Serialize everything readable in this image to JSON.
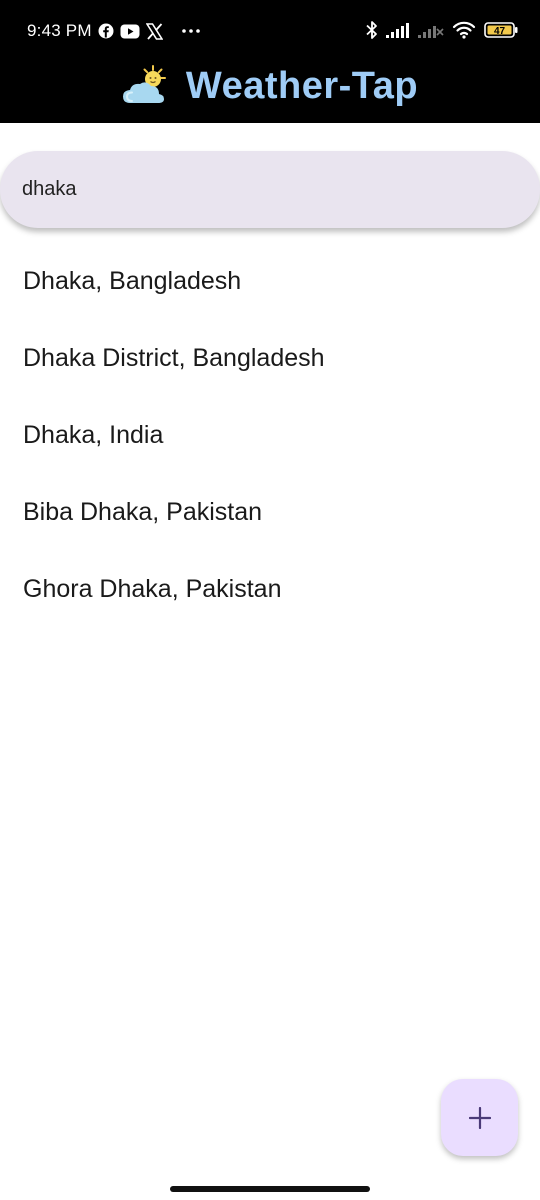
{
  "status_bar": {
    "time": "9:43 PM",
    "left_icons": [
      "facebook-icon",
      "youtube-icon",
      "x-icon",
      "more-dots-icon"
    ],
    "right_icons": [
      "bluetooth-icon",
      "signal-icon",
      "signal-noservice-icon",
      "wifi-icon",
      "battery-icon"
    ],
    "battery_level": "47"
  },
  "header": {
    "logo_icon": "sun-cloud-icon",
    "title": "Weather-Tap"
  },
  "search": {
    "value": "dhaka",
    "icon": "none"
  },
  "results": [
    {
      "label": "Dhaka, Bangladesh"
    },
    {
      "label": "Dhaka District, Bangladesh"
    },
    {
      "label": "Dhaka, India"
    },
    {
      "label": "Biba Dhaka, Pakistan"
    },
    {
      "label": "Ghora Dhaka, Pakistan"
    }
  ],
  "fab": {
    "icon": "plus-icon"
  },
  "colors": {
    "app_bar": "#000000",
    "title": "#9fccf6",
    "search_bg": "#e9e4ef",
    "fab_bg": "#eaddff",
    "fab_icon": "#4a3a78"
  }
}
